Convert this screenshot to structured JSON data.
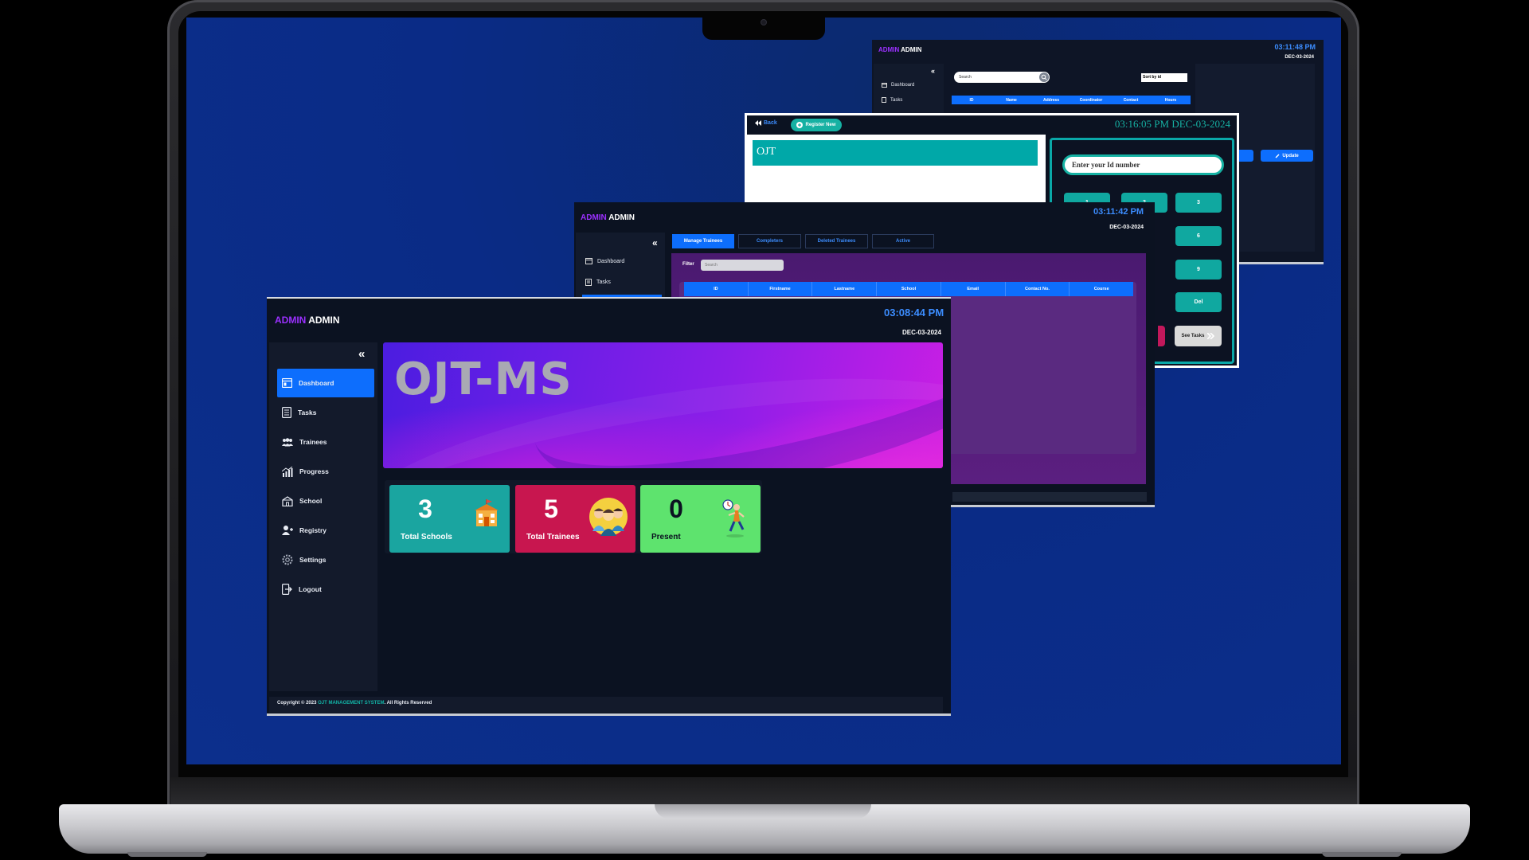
{
  "colors": {
    "accent_blue": "#0d6efd",
    "accent_purple": "#9b30ff",
    "teal": "#16b1a3",
    "clock_blue": "#3c8dff",
    "panel_dark": "#0b1221",
    "card_teal": "#1aa5a0",
    "card_crimson": "#c8164f",
    "card_green": "#5ee36e"
  },
  "dashboard": {
    "brand_accent": "ADMIN",
    "brand_name": "ADMIN",
    "time": "03:08:44 PM",
    "date": "DEC-03-2024",
    "collapse_icon": "«",
    "nav": [
      {
        "label": "Dashboard",
        "icon": "dashboard-icon",
        "active": true
      },
      {
        "label": "Tasks",
        "icon": "tasks-icon",
        "active": false
      },
      {
        "label": "Trainees",
        "icon": "trainees-icon",
        "active": false
      },
      {
        "label": "Progress",
        "icon": "progress-icon",
        "active": false
      },
      {
        "label": "School",
        "icon": "school-icon",
        "active": false
      },
      {
        "label": "Registry",
        "icon": "registry-icon",
        "active": false
      },
      {
        "label": "Settings",
        "icon": "settings-icon",
        "active": false
      },
      {
        "label": "Logout",
        "icon": "logout-icon",
        "active": false
      }
    ],
    "hero_title": "OJT-MS",
    "stats": [
      {
        "value": "3",
        "label": "Total Schools",
        "icon": "school-building-icon"
      },
      {
        "value": "5",
        "label": "Total Trainees",
        "icon": "people-icon"
      },
      {
        "value": "0",
        "label": "Present",
        "icon": "runner-icon"
      }
    ],
    "footer": {
      "prefix": "Copyright © 2023 ",
      "highlight": "OJT MANAGEMENT SYSTEM",
      "suffix": ". All Rights Reserved"
    }
  },
  "manage_window": {
    "brand_accent": "ADMIN",
    "brand_name": "ADMIN",
    "time": "03:11:42 PM",
    "date": "DEC-03-2024",
    "nav": [
      "Dashboard",
      "Tasks"
    ],
    "tabs": [
      "Manage Trainees",
      "Completers",
      "Deleted Trainees",
      "Active"
    ],
    "filter_label": "Filter",
    "search_placeholder": "Search",
    "columns": [
      "ID",
      "Firstname",
      "Lastname",
      "School",
      "Email",
      "Contact No.",
      "Course"
    ]
  },
  "kiosk_window": {
    "back_label": "Back",
    "register_label": "Register New",
    "clock": "03:16:05 PM DEC-03-2024",
    "ojt_label": "OJT",
    "id_placeholder": "Enter your Id number",
    "keys": [
      "1",
      "2",
      "3",
      "6",
      "9",
      "Del"
    ],
    "see_tasks_label": "See Tasks"
  },
  "school_window": {
    "brand_accent": "ADMIN",
    "brand_name": "ADMIN",
    "time": "03:11:48 PM",
    "date": "DEC-03-2024",
    "nav": [
      "Dashboard",
      "Tasks"
    ],
    "search_placeholder": "Search",
    "sort_label": "Sort by id",
    "columns": [
      "ID",
      "Name",
      "Address",
      "Coordinator",
      "Contact",
      "Hours"
    ],
    "update_label": "Update"
  }
}
